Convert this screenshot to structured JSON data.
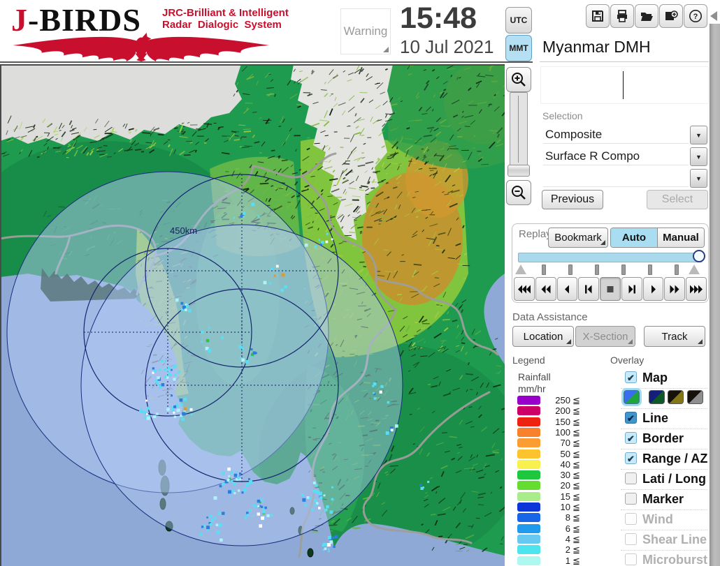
{
  "header": {
    "logo": {
      "title_red": "J",
      "title_black": "-BIRDS",
      "subtitle_line1": "JRC-Brilliant & Intelligent",
      "subtitle_line2": "Radar  Dialogic  System",
      "brand_color": "#c8102e"
    },
    "warning_button": "Warning",
    "clock": {
      "time": "15:48",
      "date": "10 Jul 2021"
    },
    "timezone": {
      "utc_label": "UTC",
      "mmt_label": "MMT",
      "selected": "MMT",
      "selected_color": "#b5e0f3"
    },
    "toolbar": {
      "icons": [
        "save-icon",
        "print-icon",
        "open-folder-icon",
        "add-image-icon",
        "help-icon"
      ]
    }
  },
  "panel": {
    "station_title": "Myanmar DMH",
    "selection": {
      "label": "Selection",
      "dropdowns": [
        {
          "value": "Composite"
        },
        {
          "value": "Surface R Compo"
        },
        {
          "value": ""
        }
      ],
      "previous_label": "Previous",
      "select_label": "Select",
      "select_enabled": false
    },
    "replay": {
      "label": "Replay",
      "bookmark_label": "Bookmark",
      "auto_label": "Auto",
      "manual_label": "Manual",
      "mode_selected": "Auto",
      "slider_fill_color": "#a9d9ec",
      "playback_buttons": [
        "rewind-fast",
        "rewind",
        "play-reverse",
        "step-back",
        "stop",
        "step-forward",
        "play",
        "forward",
        "forward-fast"
      ],
      "active_playback": "stop"
    },
    "data_assistance": {
      "label": "Data Assistance",
      "buttons": [
        {
          "label": "Location",
          "enabled": true
        },
        {
          "label": "X-Section",
          "enabled": false
        },
        {
          "label": "Track",
          "enabled": true
        }
      ]
    },
    "legend": {
      "label": "Legend",
      "title_line1": "Rainfall",
      "title_line2": "mm/hr",
      "compare_symbol": "≦",
      "entries": [
        {
          "value": "250",
          "color": "#9900cc"
        },
        {
          "value": "200",
          "color": "#cc0066"
        },
        {
          "value": "150",
          "color": "#ee2211"
        },
        {
          "value": "100",
          "color": "#f8812c"
        },
        {
          "value": "70",
          "color": "#fb9d32"
        },
        {
          "value": "50",
          "color": "#fdc32e"
        },
        {
          "value": "40",
          "color": "#f8f04c"
        },
        {
          "value": "30",
          "color": "#1ec73e"
        },
        {
          "value": "20",
          "color": "#64dc30"
        },
        {
          "value": "15",
          "color": "#a8ec8c"
        },
        {
          "value": "10",
          "color": "#0c36d8"
        },
        {
          "value": "8",
          "color": "#1965e8"
        },
        {
          "value": "6",
          "color": "#1f9aec"
        },
        {
          "value": "4",
          "color": "#66c9f2"
        },
        {
          "value": "2",
          "color": "#4ce4ee"
        },
        {
          "value": "1",
          "color": "#aef8f2"
        }
      ]
    },
    "overlay": {
      "label": "Overlay",
      "items": [
        {
          "label": "Map",
          "state": "checked"
        },
        {
          "label": "Line",
          "state": "checked-dark"
        },
        {
          "label": "Border",
          "state": "checked"
        },
        {
          "label": "Range / AZ",
          "state": "checked"
        },
        {
          "label": "Lati / Long",
          "state": "unchecked"
        },
        {
          "label": "Marker",
          "state": "unchecked"
        },
        {
          "label": "Wind",
          "state": "disabled"
        },
        {
          "label": "Shear Line",
          "state": "disabled"
        },
        {
          "label": "Microburst",
          "state": "disabled"
        }
      ],
      "map_styles": [
        {
          "selected": true,
          "upper": "#3a6cf0",
          "lower": "#1fa53c"
        },
        {
          "selected": false,
          "upper": "#131f7a",
          "lower": "#0e5a26"
        },
        {
          "selected": false,
          "upper": "#14120b",
          "lower": "#857716"
        },
        {
          "selected": false,
          "upper": "#14120b",
          "lower": "#8f8f8f"
        }
      ]
    }
  },
  "map": {
    "range_label": "450km"
  }
}
